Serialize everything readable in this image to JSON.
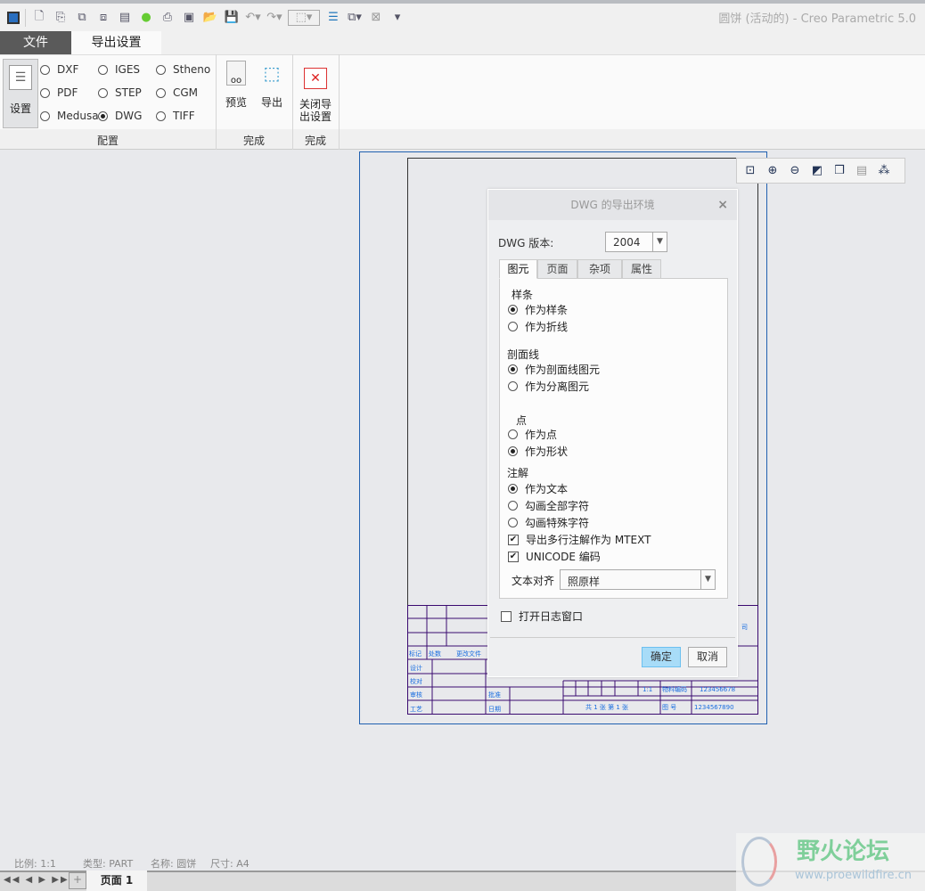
{
  "window": {
    "title": "圆饼 (活动的) - Creo Parametric 5.0"
  },
  "quick_access": {
    "icons": [
      "window-icon",
      "new-icon",
      "regenerate-icon",
      "export-icon",
      "assembly-icon",
      "sheet-icon",
      "green-light-icon",
      "print-icon",
      "save-copy-icon",
      "open-icon",
      "save-icon",
      "undo-icon",
      "redo-icon",
      "select-box-icon",
      "layers-icon",
      "windows-icon",
      "close-window-icon",
      "customize-icon"
    ]
  },
  "tabs": [
    {
      "label": "文件"
    },
    {
      "label": "导出设置"
    }
  ],
  "ribbon": {
    "settings_label": "设置",
    "formats": [
      {
        "label": "DXF",
        "selected": false
      },
      {
        "label": "IGES",
        "selected": false
      },
      {
        "label": "Stheno",
        "selected": false
      },
      {
        "label": "PDF",
        "selected": false
      },
      {
        "label": "STEP",
        "selected": false
      },
      {
        "label": "CGM",
        "selected": false
      },
      {
        "label": "Medusa",
        "selected": false
      },
      {
        "label": "DWG",
        "selected": true
      },
      {
        "label": "TIFF",
        "selected": false
      }
    ],
    "preview_label": "预览",
    "export_label": "导出",
    "close_label_1": "关闭导",
    "close_label_2": "出设置",
    "groups": [
      "配置",
      "完成",
      "完成"
    ]
  },
  "dialog": {
    "title": "DWG 的导出环境",
    "version_label": "DWG 版本:",
    "version_value": "2004",
    "tabs": [
      "图元",
      "页面",
      "杂项",
      "属性"
    ],
    "spline": {
      "label": "样条",
      "options": [
        {
          "label": "作为样条",
          "selected": true
        },
        {
          "label": "作为折线",
          "selected": false
        }
      ]
    },
    "hatch": {
      "label": "剖面线",
      "options": [
        {
          "label": "作为剖面线图元",
          "selected": true
        },
        {
          "label": "作为分离图元",
          "selected": false
        }
      ]
    },
    "point": {
      "label": "点",
      "options": [
        {
          "label": "作为点",
          "selected": false
        },
        {
          "label": "作为形状",
          "selected": true
        }
      ]
    },
    "note": {
      "label": "注解",
      "options": [
        {
          "label": "作为文本",
          "selected": true
        },
        {
          "label": "勾画全部字符",
          "selected": false
        },
        {
          "label": "勾画特殊字符",
          "selected": false
        }
      ],
      "checks": [
        {
          "label": "导出多行注解作为 MTEXT",
          "checked": true
        },
        {
          "label": "UNICODE 编码",
          "checked": true
        }
      ]
    },
    "align_label": "文本对齐",
    "align_value": "照原样",
    "log_label": "打开日志窗口",
    "log_checked": false,
    "ok": "确定",
    "cancel": "取消"
  },
  "title_block": {
    "mark": "标记",
    "count": "处数",
    "change": "更改文件",
    "design": "设计",
    "check": "校对",
    "review": "审核",
    "process": "工艺",
    "approve": "批准",
    "date": "日期",
    "scale": "1:1",
    "material": "物料编码",
    "material_no": "123456678",
    "sheets": "共 1 张  第 1 张",
    "drawing_no_label": "图 号",
    "drawing_no": "1234567890",
    "company": "司"
  },
  "status": {
    "scale": "比例: 1:1",
    "type": "类型: PART",
    "name": "名称: 圆饼",
    "size": "尺寸: A4"
  },
  "pagebar": {
    "page": "页面 1"
  },
  "watermark": {
    "text": "野火论坛",
    "url": "www.proewildfire.cn"
  }
}
